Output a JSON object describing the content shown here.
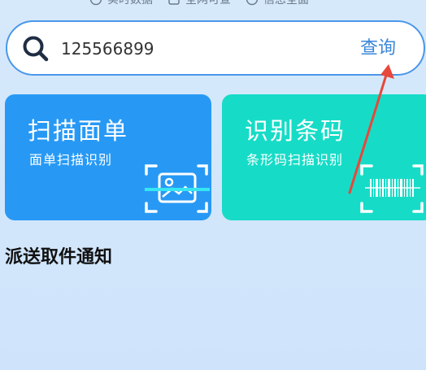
{
  "top_nav": {
    "items": [
      {
        "label": "实时数据",
        "icon": "clock-icon"
      },
      {
        "label": "全网可查",
        "icon": "search-doc-icon"
      },
      {
        "label": "信息全面",
        "icon": "info-icon"
      }
    ]
  },
  "search": {
    "value": "125566899",
    "button_label": "查询",
    "icon": "search-icon"
  },
  "cards": [
    {
      "title": "扫描面单",
      "subtitle": "面单扫描识别",
      "icon": "scan-photo-icon",
      "color": "#2799f5"
    },
    {
      "title": "识别条码",
      "subtitle": "条形码扫描识别",
      "icon": "barcode-scan-icon",
      "color": "#16dcc7"
    }
  ],
  "section": {
    "title": "派送取件通知"
  },
  "annotation": {
    "arrow_color": "#e8473b"
  },
  "colors": {
    "accent": "#3b87d9",
    "search_border": "#4a97e8",
    "background": "#d4e8fb"
  }
}
